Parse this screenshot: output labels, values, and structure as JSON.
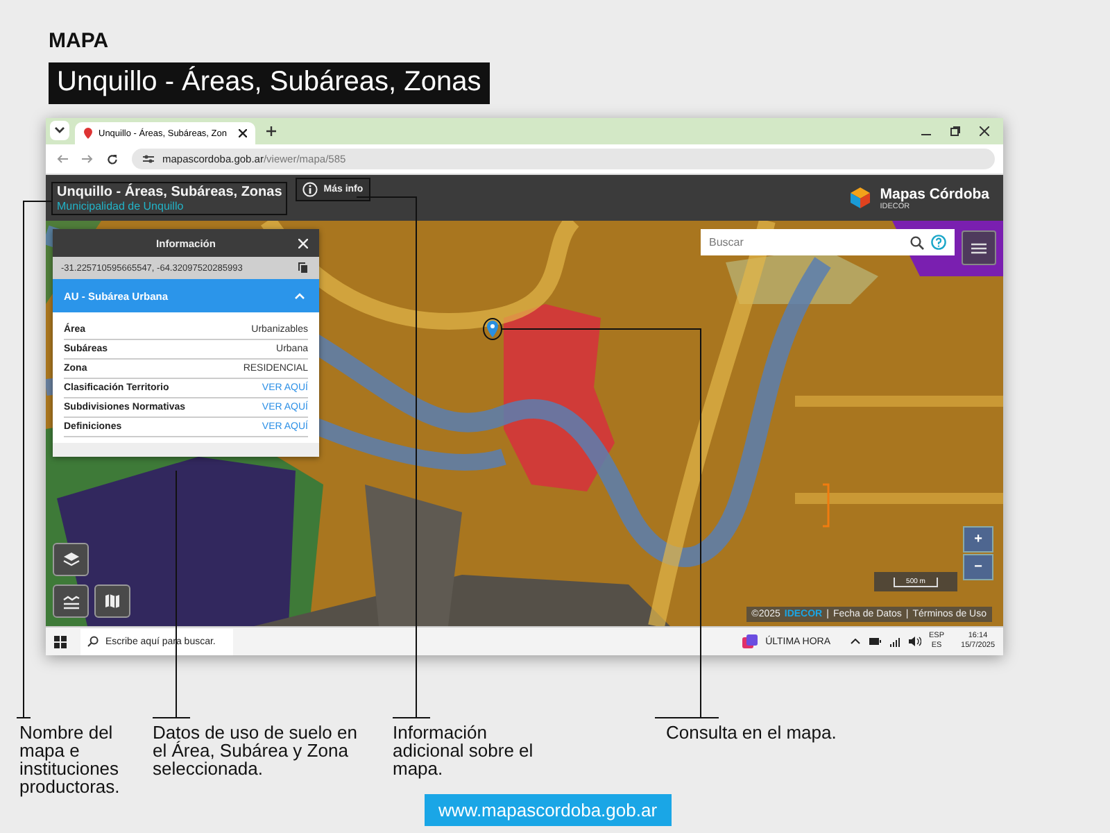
{
  "heading": "MAPA",
  "title": "Unquillo - Áreas, Subáreas, Zonas",
  "browser": {
    "tab_title": "Unquillo - Áreas, Subáreas, Zon",
    "url_host": "mapascordoba.gob.ar",
    "url_path": "/viewer/mapa/585"
  },
  "app": {
    "map_title": "Unquillo - Áreas, Subáreas, Zonas",
    "subtitle": "Municipalidad de Unquillo",
    "more_info": "Más info",
    "logo_name": "Mapas Córdoba",
    "logo_sub": "IDECOR",
    "search": {
      "placeholder": "Buscar"
    }
  },
  "info_panel": {
    "title": "Información",
    "coordinates": "-31.225710595665547, -64.32097520285993",
    "section": {
      "title": "AU - Subárea Urbana",
      "expanded": true
    },
    "rows": [
      {
        "label": "Área",
        "value": "Urbanizables",
        "kind": "text"
      },
      {
        "label": "Subáreas",
        "value": "Urbana",
        "kind": "text"
      },
      {
        "label": "Zona",
        "value": "RESIDENCIAL",
        "kind": "text"
      },
      {
        "label": "Clasificación Territorio",
        "value": "VER AQUÍ",
        "kind": "link"
      },
      {
        "label": "Subdivisiones Normativas",
        "value": "VER AQUÍ",
        "kind": "link"
      },
      {
        "label": "Definiciones",
        "value": "VER AQUÍ",
        "kind": "link"
      }
    ]
  },
  "zoom_controls": [
    "+",
    "−"
  ],
  "scale": "500 m",
  "attribution": {
    "copyright": "©2025",
    "org": "IDECOR",
    "separator": "|",
    "links": [
      "Fecha de Datos",
      "Términos de Uso"
    ]
  },
  "taskbar": {
    "search_placeholder": "Escribe aquí para buscar.",
    "news": "ÚLTIMA HORA",
    "lang_top": "ESP",
    "lang_bottom": "ES",
    "time": "16:14",
    "date": "15/7/2025"
  },
  "annotations": [
    "Nombre del mapa e instituciones productoras.",
    "Datos de uso de suelo en el Área, Subárea y Zona seleccionada.",
    "Información adicional sobre el mapa.",
    "Consulta en el mapa."
  ],
  "footer_link": "www.mapascordoba.gob.ar"
}
